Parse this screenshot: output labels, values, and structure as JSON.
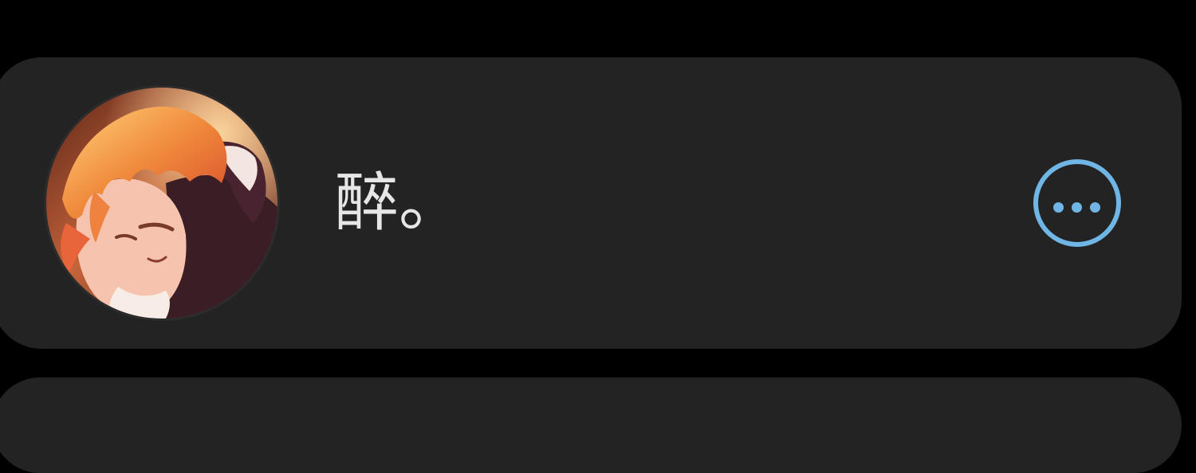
{
  "contact": {
    "name": "醉。",
    "avatar_icon": "anime-character-avatar-icon",
    "more_icon": "more-options-icon"
  },
  "colors": {
    "page_background": "#000000",
    "card_background": "#232323",
    "name_text": "#e6e6e6",
    "accent": "#6fb6e6"
  }
}
